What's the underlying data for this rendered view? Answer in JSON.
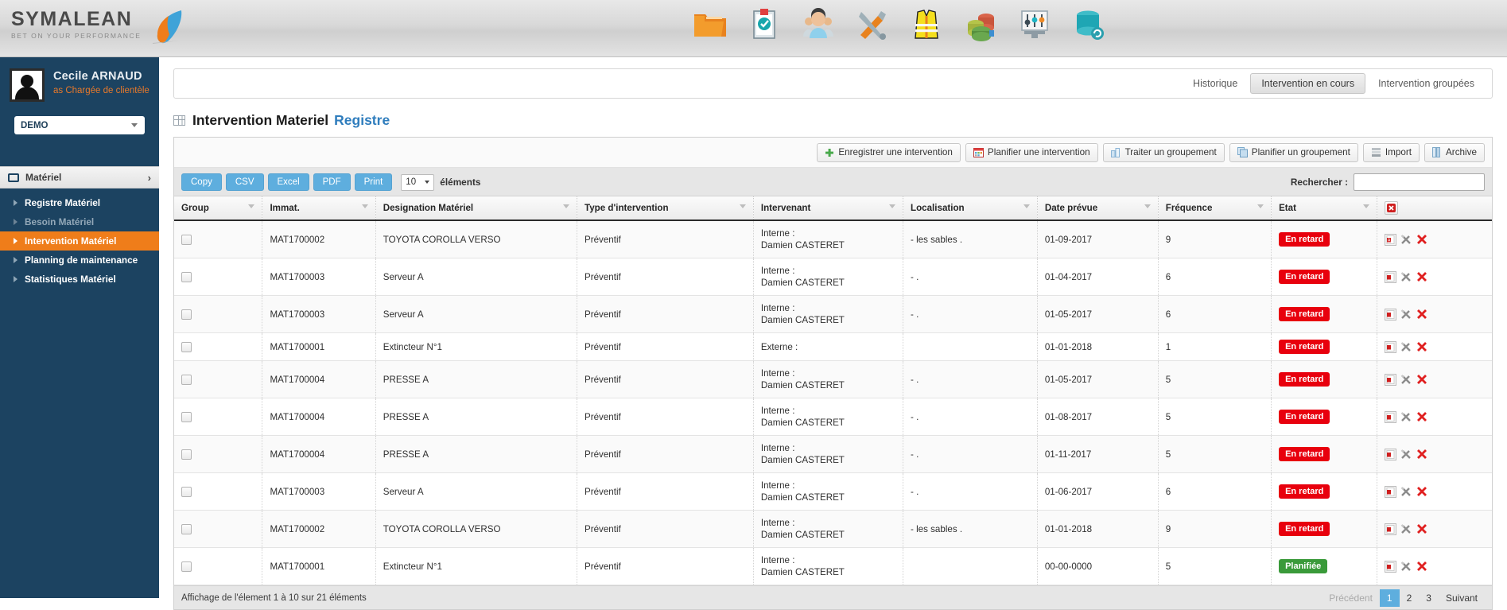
{
  "brand": {
    "name_part1": "S",
    "name": "YMALEA",
    "name_last": "N",
    "full": "SYMALEAN",
    "tagline": "Bet on your performance",
    "accent_orange": "#ef7d1a",
    "accent_blue": "#2f7dbd",
    "sidebar_bg": "#1c4361"
  },
  "header": {
    "icons": [
      {
        "name": "folder-icon",
        "label": "Documents"
      },
      {
        "name": "clipboard-check-icon",
        "label": "Audits"
      },
      {
        "name": "users-icon",
        "label": "Personnel"
      },
      {
        "name": "tools-icon",
        "label": "Materiel"
      },
      {
        "name": "safety-vest-icon",
        "label": "Securite"
      },
      {
        "name": "pie-chart-icon",
        "label": "Statistiques"
      },
      {
        "name": "settings-sliders-icon",
        "label": "Parametrage"
      },
      {
        "name": "database-sync-icon",
        "label": "Donnees"
      }
    ]
  },
  "user": {
    "name": "Cecile ARNAUD",
    "role": "as Chargée de clientèle",
    "company_selected": "DEMO"
  },
  "sidebar": {
    "section_label": "Matériel",
    "section_icon": "monitor-icon",
    "items": [
      {
        "label": "Registre Matériel",
        "state": "normal"
      },
      {
        "label": "Besoin Matériel",
        "state": "dim"
      },
      {
        "label": "Intervention Matériel",
        "state": "active"
      },
      {
        "label": "Planning de maintenance",
        "state": "normal"
      },
      {
        "label": "Statistiques Matériel",
        "state": "normal"
      }
    ]
  },
  "tabs": [
    {
      "label": "Historique",
      "active": false
    },
    {
      "label": "Intervention en cours",
      "active": true
    },
    {
      "label": "Intervention groupées",
      "active": false
    }
  ],
  "page": {
    "title": "Intervention Materiel",
    "title_sub": "Registre"
  },
  "toolbar": {
    "buttons": [
      {
        "label": "Enregistrer une intervention",
        "icon": "plus-icon"
      },
      {
        "label": "Planifier une intervention",
        "icon": "calendar-icon"
      },
      {
        "label": "Traiter un groupement",
        "icon": "columns-icon"
      },
      {
        "label": "Planifier un groupement",
        "icon": "copy-icon"
      },
      {
        "label": "Import",
        "icon": "import-icon"
      },
      {
        "label": "Archive",
        "icon": "archive-icon"
      }
    ]
  },
  "datatable": {
    "export_buttons": [
      "Copy",
      "CSV",
      "Excel",
      "PDF",
      "Print"
    ],
    "length_value": "10",
    "length_label": "éléments",
    "search_label": "Rechercher :",
    "search_value": "",
    "search_placeholder": "",
    "columns": [
      {
        "label": "Group",
        "sortable": true
      },
      {
        "label": "Immat.",
        "sortable": true
      },
      {
        "label": "Designation Matériel",
        "sortable": true
      },
      {
        "label": "Type d'intervention",
        "sortable": true
      },
      {
        "label": "Intervenant",
        "sortable": true
      },
      {
        "label": "Localisation",
        "sortable": true
      },
      {
        "label": "Date prévue",
        "sortable": true
      },
      {
        "label": "Fréquence",
        "sortable": true
      },
      {
        "label": "Etat",
        "sortable": true
      },
      {
        "label": "",
        "sortable": false,
        "icon": "delete-all-icon"
      }
    ],
    "rows": [
      {
        "immat": "MAT1700002",
        "designation": "TOYOTA COROLLA VERSO",
        "type": "Préventif",
        "intervenant_type": "Interne :",
        "intervenant_name": "Damien CASTERET",
        "localisation": "- les sables .",
        "date": "01-09-2017",
        "frequence": "9",
        "etat": "En retard",
        "etat_kind": "retard"
      },
      {
        "immat": "MAT1700003",
        "designation": "Serveur A",
        "type": "Préventif",
        "intervenant_type": "Interne :",
        "intervenant_name": "Damien CASTERET",
        "localisation": "- .",
        "date": "01-04-2017",
        "frequence": "6",
        "etat": "En retard",
        "etat_kind": "retard"
      },
      {
        "immat": "MAT1700003",
        "designation": "Serveur A",
        "type": "Préventif",
        "intervenant_type": "Interne :",
        "intervenant_name": "Damien CASTERET",
        "localisation": "- .",
        "date": "01-05-2017",
        "frequence": "6",
        "etat": "En retard",
        "etat_kind": "retard"
      },
      {
        "immat": "MAT1700001",
        "designation": "Extincteur N°1",
        "type": "Préventif",
        "intervenant_type": "Externe :",
        "intervenant_name": "",
        "localisation": "",
        "date": "01-01-2018",
        "frequence": "1",
        "etat": "En retard",
        "etat_kind": "retard"
      },
      {
        "immat": "MAT1700004",
        "designation": "PRESSE A",
        "type": "Préventif",
        "intervenant_type": "Interne :",
        "intervenant_name": "Damien CASTERET",
        "localisation": "- .",
        "date": "01-05-2017",
        "frequence": "5",
        "etat": "En retard",
        "etat_kind": "retard"
      },
      {
        "immat": "MAT1700004",
        "designation": "PRESSE A",
        "type": "Préventif",
        "intervenant_type": "Interne :",
        "intervenant_name": "Damien CASTERET",
        "localisation": "- .",
        "date": "01-08-2017",
        "frequence": "5",
        "etat": "En retard",
        "etat_kind": "retard"
      },
      {
        "immat": "MAT1700004",
        "designation": "PRESSE A",
        "type": "Préventif",
        "intervenant_type": "Interne :",
        "intervenant_name": "Damien CASTERET",
        "localisation": "- .",
        "date": "01-11-2017",
        "frequence": "5",
        "etat": "En retard",
        "etat_kind": "retard"
      },
      {
        "immat": "MAT1700003",
        "designation": "Serveur A",
        "type": "Préventif",
        "intervenant_type": "Interne :",
        "intervenant_name": "Damien CASTERET",
        "localisation": "- .",
        "date": "01-06-2017",
        "frequence": "6",
        "etat": "En retard",
        "etat_kind": "retard"
      },
      {
        "immat": "MAT1700002",
        "designation": "TOYOTA COROLLA VERSO",
        "type": "Préventif",
        "intervenant_type": "Interne :",
        "intervenant_name": "Damien CASTERET",
        "localisation": "- les sables .",
        "date": "01-01-2018",
        "frequence": "9",
        "etat": "En retard",
        "etat_kind": "retard"
      },
      {
        "immat": "MAT1700001",
        "designation": "Extincteur N°1",
        "type": "Préventif",
        "intervenant_type": "Interne :",
        "intervenant_name": "Damien CASTERET",
        "localisation": "",
        "date": "00-00-0000",
        "frequence": "5",
        "etat": "Planifiée",
        "etat_kind": "planifiee"
      }
    ],
    "info": "Affichage de l'élement 1 à 10 sur 21 éléments",
    "pagination": {
      "prev": "Précédent",
      "pages": [
        "1",
        "2",
        "3"
      ],
      "current": "1",
      "next": "Suivant"
    }
  }
}
